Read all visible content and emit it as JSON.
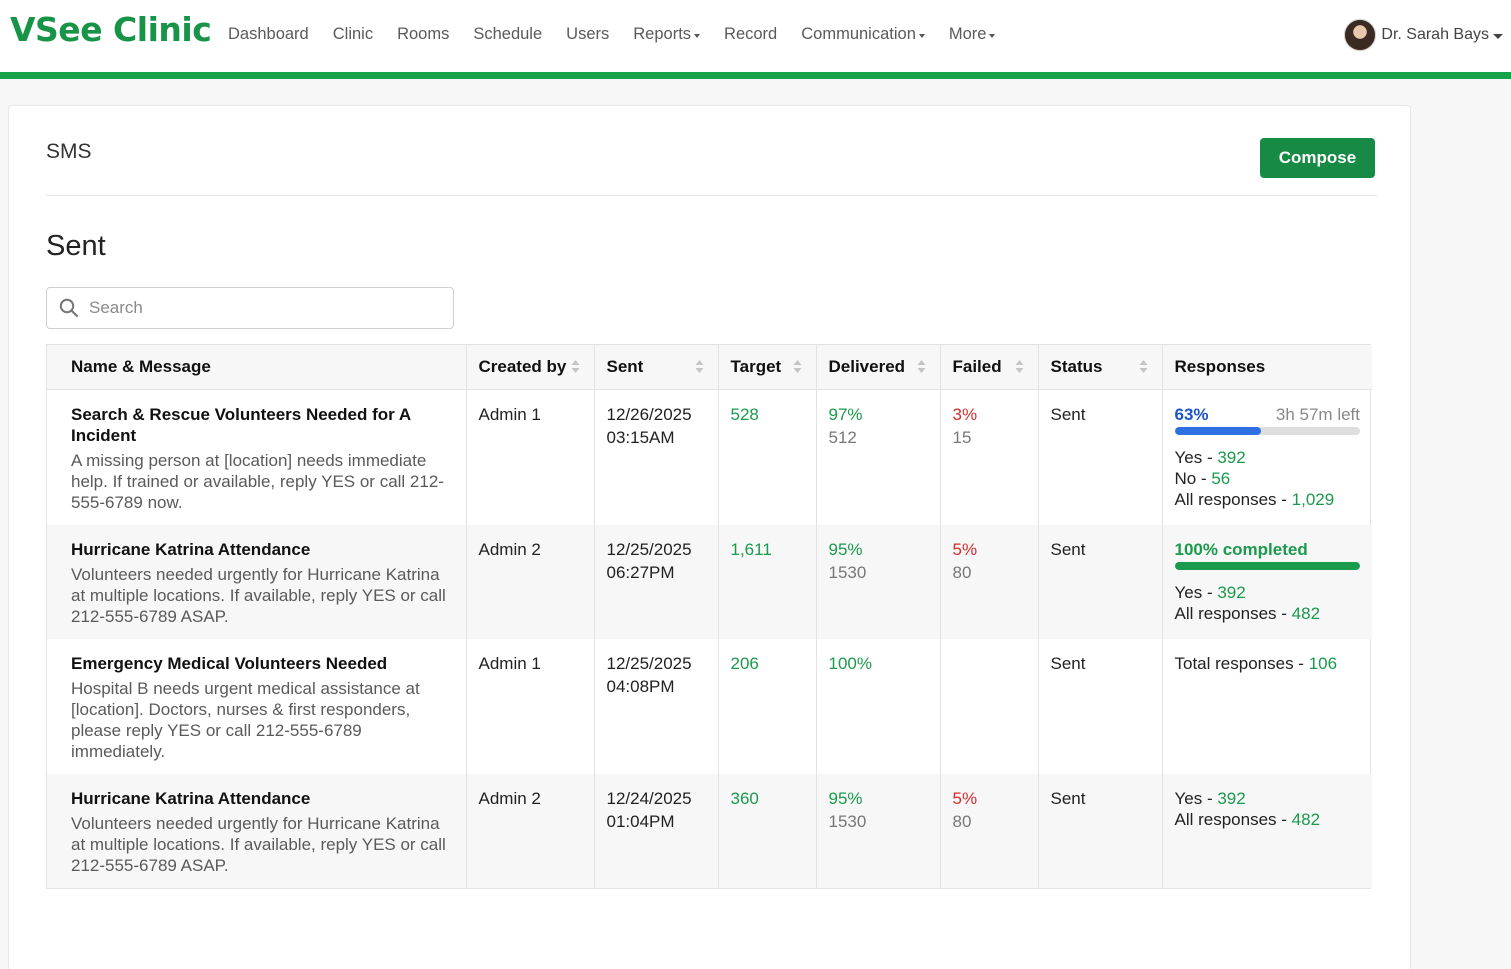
{
  "app": {
    "logo": "VSee Clinic",
    "brand_color": "#179447"
  },
  "nav": {
    "items": [
      {
        "label": "Dashboard",
        "dropdown": false
      },
      {
        "label": "Clinic",
        "dropdown": false
      },
      {
        "label": "Rooms",
        "dropdown": false
      },
      {
        "label": "Schedule",
        "dropdown": false
      },
      {
        "label": "Users",
        "dropdown": false
      },
      {
        "label": "Reports",
        "dropdown": true
      },
      {
        "label": "Record",
        "dropdown": false
      },
      {
        "label": "Communication",
        "dropdown": true
      },
      {
        "label": "More",
        "dropdown": true
      }
    ]
  },
  "user": {
    "name": "Dr. Sarah Bays",
    "avatar_icon": "avatar"
  },
  "page": {
    "title": "SMS",
    "compose_label": "Compose",
    "section_title": "Sent"
  },
  "search": {
    "placeholder": "Search",
    "value": "",
    "icon": "search-icon"
  },
  "table": {
    "columns": [
      {
        "label": "Name & Message",
        "sortable": false
      },
      {
        "label": "Created by",
        "sortable": true
      },
      {
        "label": "Sent",
        "sortable": true
      },
      {
        "label": "Target",
        "sortable": true
      },
      {
        "label": "Delivered",
        "sortable": true
      },
      {
        "label": "Failed",
        "sortable": true
      },
      {
        "label": "Status",
        "sortable": true
      },
      {
        "label": "Responses",
        "sortable": false
      }
    ],
    "rows": [
      {
        "title": "Search & Rescue Volunteers Needed for A Incident",
        "message": "A missing person at [location] needs immediate help. If trained or available, reply YES or call 212-555-6789 now.",
        "created_by": "Admin 1",
        "sent_date": "12/26/2025",
        "sent_time": "03:15AM",
        "target": "528",
        "delivered_pct": "97%",
        "delivered_count": "512",
        "failed_pct": "3%",
        "failed_count": "15",
        "status": "Sent",
        "responses": {
          "progress_label": "63%",
          "progress_value": 0.47,
          "progress_color": "#2f6fe4",
          "time_left": "3h 57m left",
          "lines": [
            {
              "label": "Yes - ",
              "value": "392"
            },
            {
              "label": "No - ",
              "value": "56"
            },
            {
              "label": "All responses - ",
              "value": "1,029"
            }
          ]
        }
      },
      {
        "title": "Hurricane Katrina Attendance",
        "message": "Volunteers needed urgently for Hurricane Katrina at multiple locations. If available, reply YES or call 212-555-6789 ASAP.",
        "created_by": "Admin 2",
        "sent_date": "12/25/2025",
        "sent_time": "06:27PM",
        "target": "1,611",
        "delivered_pct": "95%",
        "delivered_count": "1530",
        "failed_pct": "5%",
        "failed_count": "80",
        "status": "Sent",
        "responses": {
          "progress_label": "100% completed",
          "progress_value": 1.0,
          "progress_color": "#1a9a4c",
          "time_left": "",
          "lines": [
            {
              "label": "Yes - ",
              "value": "392"
            },
            {
              "label": "All responses - ",
              "value": "482"
            }
          ]
        }
      },
      {
        "title": "Emergency Medical Volunteers Needed",
        "message": "Hospital B needs urgent medical assistance at [location]. Doctors, nurses & first responders, please reply YES or call 212-555-6789 immediately.",
        "created_by": "Admin 1",
        "sent_date": "12/25/2025",
        "sent_time": "04:08PM",
        "target": "206",
        "delivered_pct": "100%",
        "delivered_count": "",
        "failed_pct": "",
        "failed_count": "",
        "status": "Sent",
        "responses": {
          "progress_label": "",
          "progress_value": null,
          "time_left": "",
          "lines": [
            {
              "label": "Total responses - ",
              "value": "106"
            }
          ]
        }
      },
      {
        "title": "Hurricane Katrina Attendance",
        "message": "Volunteers needed urgently for Hurricane Katrina at multiple locations. If available, reply YES or call 212-555-6789 ASAP.",
        "created_by": "Admin 2",
        "sent_date": "12/24/2025",
        "sent_time": "01:04PM",
        "target": "360",
        "delivered_pct": "95%",
        "delivered_count": "1530",
        "failed_pct": "5%",
        "failed_count": "80",
        "status": "Sent",
        "responses": {
          "progress_label": "",
          "progress_value": null,
          "time_left": "",
          "lines": [
            {
              "label": "Yes - ",
              "value": "392"
            },
            {
              "label": "All responses - ",
              "value": "482"
            }
          ]
        }
      }
    ]
  },
  "colors": {
    "accent_green": "#16a34a",
    "compose_button": "#178a45",
    "value_green": "#1a9a4c",
    "value_red": "#d62b2b",
    "progress_blue": "#2f6fe4"
  }
}
